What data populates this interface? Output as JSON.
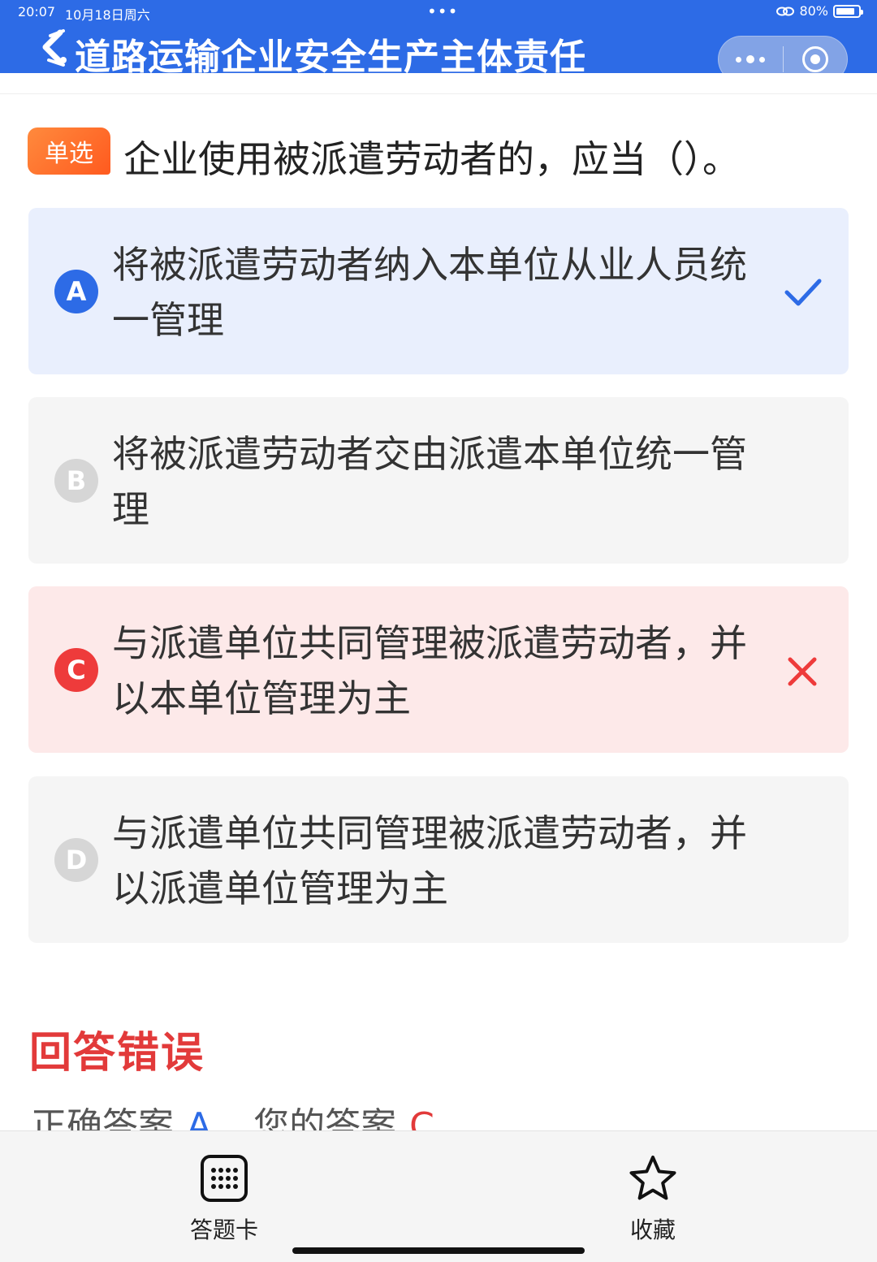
{
  "status_bar": {
    "time": "20:07",
    "date": "10月18日周六",
    "center_dots": "•••",
    "battery": "80%"
  },
  "header": {
    "title": "道路运输企业安全生产主体责任",
    "more_icon": "more-dots-icon",
    "record_icon": "record-icon"
  },
  "question": {
    "type_badge": "单选",
    "text": "企业使用被派遣劳动者的，应当（）。"
  },
  "options": [
    {
      "letter": "A",
      "text": "将被派遣劳动者纳入本单位从业人员统一管理",
      "state": "correct"
    },
    {
      "letter": "B",
      "text": "将被派遣劳动者交由派遣本单位统一管理",
      "state": "neutral"
    },
    {
      "letter": "C",
      "text": "与派遣单位共同管理被派遣劳动者，并以本单位管理为主",
      "state": "wrong"
    },
    {
      "letter": "D",
      "text": "与派遣单位共同管理被派遣劳动者，并以派遣单位管理为主",
      "state": "neutral"
    }
  ],
  "result": {
    "title": "回答错误",
    "correct_label": "正确答案",
    "correct_value": "A",
    "your_label": "您的答案",
    "your_value": "C"
  },
  "bottom_bar": {
    "answer_card_label": "答题卡",
    "favorite_label": "收藏"
  },
  "colors": {
    "primary": "#2d6be6",
    "error": "#e23a3a",
    "badge": "#ff6a2a",
    "correct_bg": "#e9effd",
    "wrong_bg": "#fde9e9"
  }
}
